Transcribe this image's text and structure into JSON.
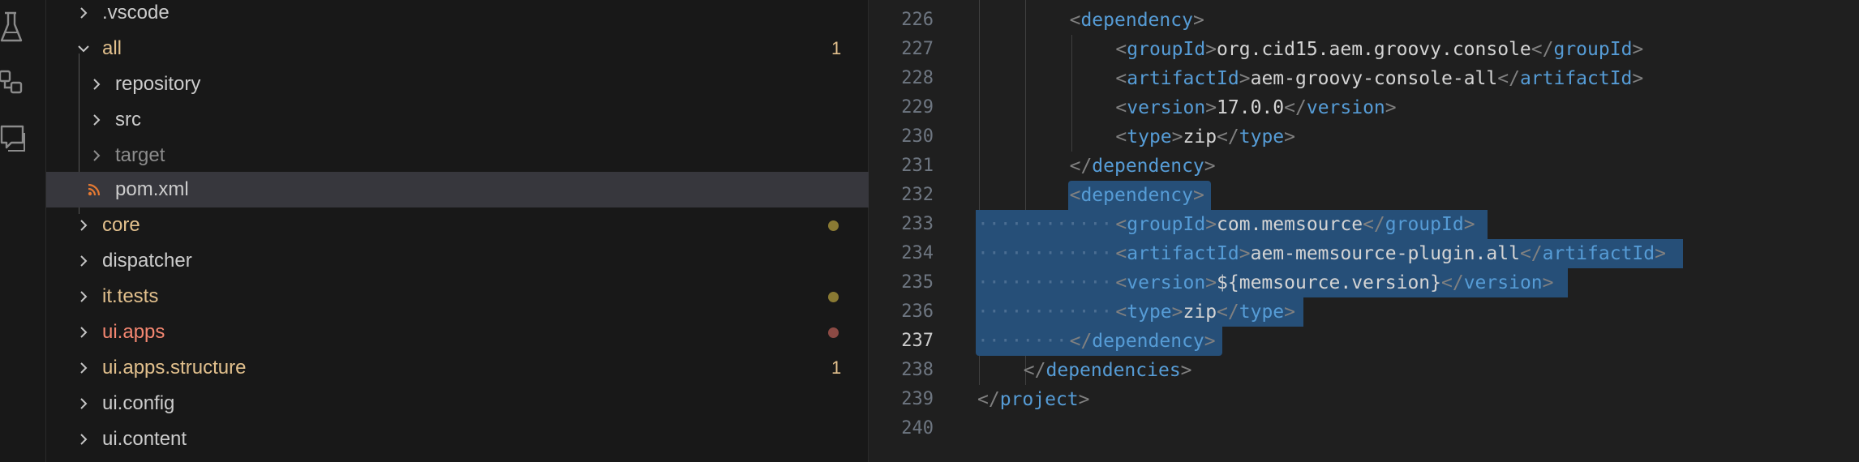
{
  "activity_bar": {
    "icons": [
      "testing-beaker-icon",
      "source-control-graph-icon",
      "remote-explorer-icon"
    ]
  },
  "explorer": {
    "items": [
      {
        "label": ".vscode",
        "expanded": false,
        "color": "#cccccc"
      },
      {
        "label": "all",
        "expanded": true,
        "color": "#e2c08d",
        "badge": "1"
      },
      {
        "label": "repository",
        "expanded": false,
        "color": "#cccccc"
      },
      {
        "label": "src",
        "expanded": false,
        "color": "#cccccc"
      },
      {
        "label": "target",
        "expanded": false,
        "color": "#8c8c8c"
      },
      {
        "label": "pom.xml",
        "file": true,
        "color": "#cccccc",
        "selected": true
      },
      {
        "label": "core",
        "expanded": false,
        "color": "#e2c08d",
        "dot": "#8a7a33"
      },
      {
        "label": "dispatcher",
        "expanded": false,
        "color": "#cccccc"
      },
      {
        "label": "it.tests",
        "expanded": false,
        "color": "#e2c08d",
        "dot": "#8a7a33"
      },
      {
        "label": "ui.apps",
        "expanded": false,
        "color": "#f48771",
        "dot": "#8c4a44"
      },
      {
        "label": "ui.apps.structure",
        "expanded": false,
        "color": "#e2c08d",
        "badge": "1"
      },
      {
        "label": "ui.config",
        "expanded": false,
        "color": "#cccccc"
      },
      {
        "label": "ui.content",
        "expanded": false,
        "color": "#cccccc"
      }
    ]
  },
  "editor": {
    "current_line": "237",
    "lines": [
      {
        "num": "226",
        "indent": 2,
        "tag": "dependency",
        "closing": false
      },
      {
        "num": "227",
        "indent": 3,
        "tag": "groupId",
        "value": "org.cid15.aem.groovy.console"
      },
      {
        "num": "228",
        "indent": 3,
        "tag": "artifactId",
        "value": "aem-groovy-console-all"
      },
      {
        "num": "229",
        "indent": 3,
        "tag": "version",
        "value": "17.0.0"
      },
      {
        "num": "230",
        "indent": 3,
        "tag": "type",
        "value": "zip"
      },
      {
        "num": "231",
        "indent": 2,
        "tag": "dependency",
        "closing": true
      },
      {
        "num": "232",
        "indent": 2,
        "tag": "dependency",
        "closing": false
      },
      {
        "num": "233",
        "indent": 3,
        "tag": "groupId",
        "value": "com.memsource"
      },
      {
        "num": "234",
        "indent": 3,
        "tag": "artifactId",
        "value": "aem-memsource-plugin.all"
      },
      {
        "num": "235",
        "indent": 3,
        "tag": "version",
        "value": "${memsource.version}"
      },
      {
        "num": "236",
        "indent": 3,
        "tag": "type",
        "value": "zip"
      },
      {
        "num": "237",
        "indent": 2,
        "tag": "dependency",
        "closing": true
      },
      {
        "num": "238",
        "indent": 1,
        "tag": "dependencies",
        "closing": true
      },
      {
        "num": "239",
        "indent": 0,
        "tag": "project",
        "closing": true
      },
      {
        "num": "240",
        "indent": 0,
        "empty": true
      }
    ]
  },
  "colors": {
    "selection": "#264f78",
    "tag": "#569cd6",
    "punctuation": "#808080",
    "text": "#d4d4d4"
  }
}
